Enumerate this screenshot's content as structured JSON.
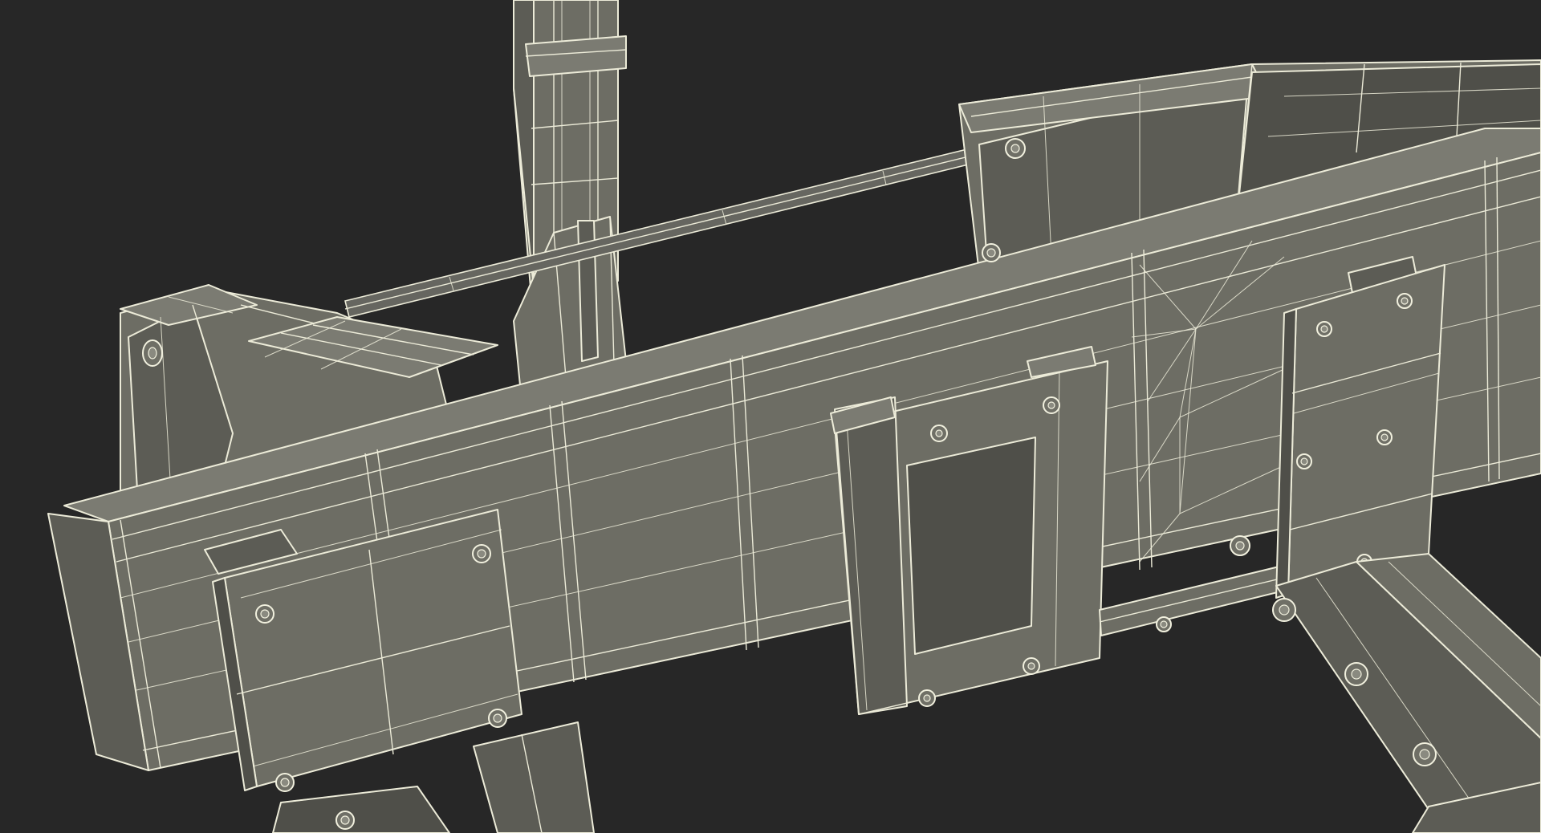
{
  "scene": {
    "subject": "",
    "background_color": "#272727",
    "mesh_fill_color": "#6d6d64",
    "wire_color": "#ecebd8"
  }
}
